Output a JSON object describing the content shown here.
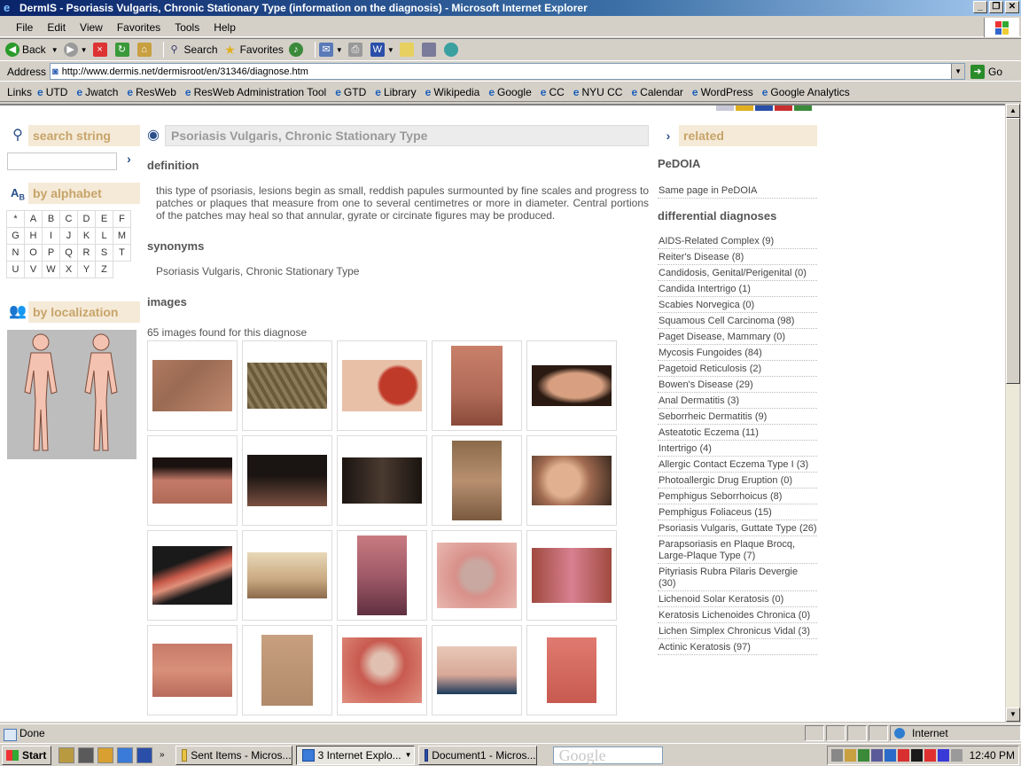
{
  "window": {
    "title": "DermIS - Psoriasis Vulgaris, Chronic Stationary Type (information on the diagnosis) - Microsoft Internet Explorer"
  },
  "menu": [
    "File",
    "Edit",
    "View",
    "Favorites",
    "Tools",
    "Help"
  ],
  "toolbar": {
    "back": "Back",
    "search": "Search",
    "favorites": "Favorites"
  },
  "address": {
    "label": "Address",
    "url": "http://www.dermis.net/dermisroot/en/31346/diagnose.htm",
    "go": "Go"
  },
  "links": {
    "label": "Links",
    "items": [
      "UTD",
      "Jwatch",
      "ResWeb",
      "ResWeb Administration Tool",
      "GTD",
      "Library",
      "Wikipedia",
      "Google",
      "CC",
      "NYU CC",
      "Calendar",
      "WordPress",
      "Google Analytics"
    ]
  },
  "left": {
    "search_title": "search string",
    "alphabet_title": "by alphabet",
    "letters": [
      "*",
      "A",
      "B",
      "C",
      "D",
      "E",
      "F",
      "G",
      "H",
      "I",
      "J",
      "K",
      "L",
      "M",
      "N",
      "O",
      "P",
      "Q",
      "R",
      "S",
      "T",
      "U",
      "V",
      "W",
      "X",
      "Y",
      "Z"
    ],
    "localization_title": "by localization"
  },
  "center": {
    "title": "Psoriasis Vulgaris, Chronic Stationary Type",
    "definition_heading": "definition",
    "definition_text": "this type of psoriasis, lesions begin as small, reddish papules surmounted by fine scales and progress to patches or plaques that measure from one to several centimetres or more in diameter. Central portions of the patches may heal so that annular, gyrate or circinate figures may be produced.",
    "synonyms_heading": "synonyms",
    "synonym": "Psoriasis Vulgaris, Chronic Stationary Type",
    "images_heading": "images",
    "images_count": "65 images found for this diagnose"
  },
  "right": {
    "title": "related",
    "pedoia_heading": "PeDOIA",
    "pedoia_link": "Same page in PeDOIA",
    "dd_heading": "differential diagnoses",
    "dd_items": [
      "AIDS-Related Complex (9)",
      "Reiter's Disease (8)",
      "Candidosis, Genital/Perigenital (0)",
      "Candida Intertrigo (1)",
      "Scabies Norvegica (0)",
      "Squamous Cell Carcinoma (98)",
      "Paget Disease, Mammary (0)",
      "Mycosis Fungoides (84)",
      "Pagetoid Reticulosis (2)",
      "Bowen's Disease (29)",
      "Anal Dermatitis (3)",
      "Seborrheic Dermatitis (9)",
      "Asteatotic Eczema (11)",
      "Intertrigo (4)",
      "Allergic Contact Eczema Type I (3)",
      "Photoallergic Drug Eruption (0)",
      "Pemphigus Seborrhoicus (8)",
      "Pemphigus Foliaceus (15)",
      "Psoriasis Vulgaris, Guttate Type (26)",
      "Parapsoriasis en Plaque Brocq, Large-Plaque Type (7)",
      "Pityriasis Rubra Pilaris Devergie (30)",
      "Lichenoid Solar Keratosis (0)",
      "Keratosis Lichenoides Chronica (0)",
      "Lichen Simplex Chronicus Vidal (3)",
      "Actinic Keratosis (97)"
    ]
  },
  "status": {
    "text": "Done",
    "zone": "Internet"
  },
  "taskbar": {
    "start": "Start",
    "buttons": [
      "Sent Items - Micros...",
      "3 Internet Explo...",
      "Document1 - Micros..."
    ],
    "search_placeholder": "Google",
    "clock": "12:40 PM"
  },
  "colors": {
    "section_bg": "#f5ead7",
    "section_text": "#c7a46a",
    "titlebar": "#0a246a"
  }
}
